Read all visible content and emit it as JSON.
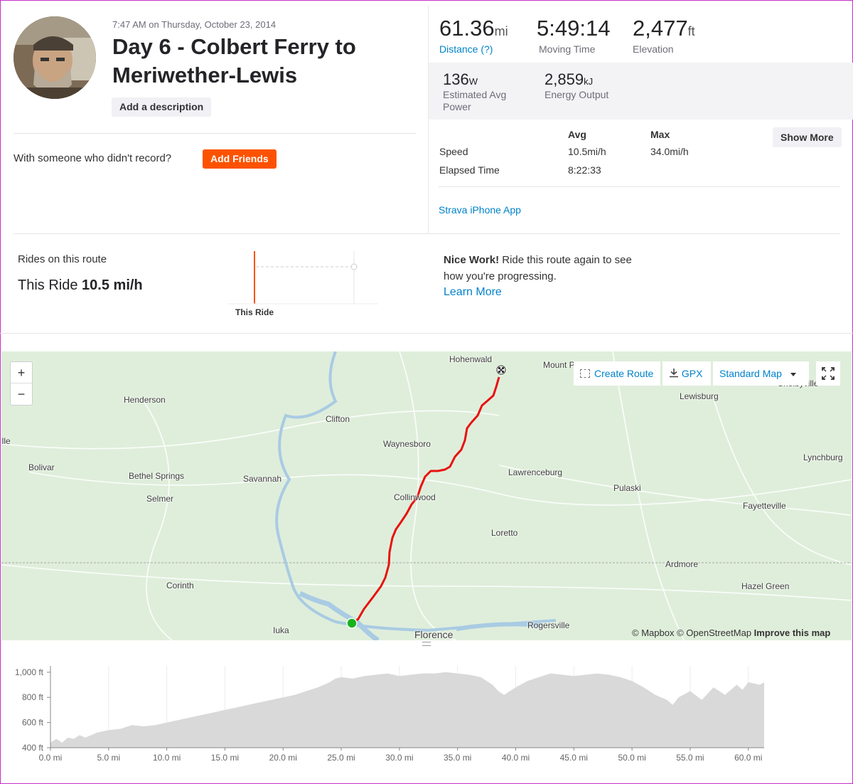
{
  "activity": {
    "timestamp": "7:47 AM on Thursday, October 23, 2014",
    "title": "Day 6 - Colbert Ferry to Meriwether-Lewis",
    "add_description": "Add a description",
    "with_someone": "With someone who didn't record?",
    "add_friends": "Add Friends"
  },
  "stats": {
    "distance": {
      "value": "61.36",
      "unit": "mi",
      "label": "Distance (?)"
    },
    "moving_time": {
      "value": "5:49:14",
      "label": "Moving Time"
    },
    "elevation": {
      "value": "2,477",
      "unit": "ft",
      "label": "Elevation"
    },
    "power": {
      "value": "136",
      "unit": "W",
      "label": "Estimated Avg Power"
    },
    "energy": {
      "value": "2,859",
      "unit": "kJ",
      "label": "Energy Output"
    },
    "table": {
      "avg_header": "Avg",
      "max_header": "Max",
      "rows": [
        {
          "label": "Speed",
          "avg": "10.5mi/h",
          "max": "34.0mi/h"
        },
        {
          "label": "Elapsed Time",
          "avg": "8:22:33",
          "max": ""
        }
      ]
    },
    "show_more": "Show More",
    "device_link": "Strava iPhone App"
  },
  "route": {
    "rides_label": "Rides on this route",
    "this_ride_prefix": "This Ride",
    "this_ride_speed": "10.5 mi/h",
    "chart_label": "This Ride",
    "nice_work_bold": "Nice Work!",
    "nice_work_text": "Ride this route again to see how you're progressing.",
    "learn_more": "Learn More"
  },
  "map": {
    "zoom_in": "+",
    "zoom_out": "−",
    "create_route": "Create Route",
    "gpx": "GPX",
    "map_type": "Standard Map",
    "attribution_mapbox": "© Mapbox",
    "attribution_osm": "© OpenStreetMap",
    "attribution_improve": "Improve this map",
    "places": [
      "Hohenwald",
      "Mount P",
      "Shelbyville",
      "Lewisburg",
      "Henderson",
      "Clifton",
      "Waynesboro",
      "ille",
      "Bolivar",
      "Bethel Springs",
      "Savannah",
      "Lawrenceburg",
      "Lynchburg",
      "Selmer",
      "Collinwood",
      "Pulaski",
      "Fayetteville",
      "Loretto",
      "Ardmore",
      "Corinth",
      "Hazel Green",
      "Iuka",
      "Florence",
      "Rogersville"
    ],
    "route_color": "#e8120f",
    "start_color": "#19b21e"
  },
  "elevation_chart": {
    "y_ticks": [
      "1,000 ft",
      "800 ft",
      "600 ft",
      "400 ft"
    ],
    "x_ticks": [
      "0.0 mi",
      "5.0 mi",
      "10.0 mi",
      "15.0 mi",
      "20.0 mi",
      "25.0 mi",
      "30.0 mi",
      "35.0 mi",
      "40.0 mi",
      "45.0 mi",
      "50.0 mi",
      "55.0 mi",
      "60.0 mi"
    ]
  },
  "chart_data": {
    "type": "area",
    "x": [
      0,
      0.5,
      1,
      1.5,
      2,
      2.5,
      3,
      4,
      5,
      6,
      7,
      8,
      9,
      10,
      11,
      12,
      13,
      14,
      15,
      16,
      17,
      18,
      19,
      20,
      21,
      22,
      23,
      24,
      24.5,
      25,
      26,
      27,
      28,
      29,
      30,
      31,
      32,
      33,
      34,
      35,
      36,
      37,
      38,
      38.5,
      39,
      39.5,
      40,
      41,
      42,
      43,
      44,
      45,
      46,
      47,
      48,
      49,
      50,
      51,
      52,
      53,
      53.5,
      54,
      55,
      56,
      57,
      58,
      59,
      59.5,
      60,
      61,
      61.36
    ],
    "y": [
      440,
      470,
      440,
      480,
      470,
      500,
      480,
      520,
      540,
      550,
      580,
      570,
      580,
      600,
      620,
      640,
      660,
      680,
      700,
      720,
      740,
      760,
      780,
      800,
      820,
      850,
      880,
      920,
      950,
      960,
      950,
      970,
      980,
      990,
      970,
      980,
      990,
      990,
      1000,
      990,
      980,
      960,
      900,
      850,
      820,
      850,
      880,
      930,
      960,
      990,
      980,
      970,
      980,
      990,
      980,
      960,
      930,
      880,
      820,
      780,
      740,
      800,
      850,
      780,
      880,
      820,
      900,
      860,
      920,
      900,
      920
    ],
    "xlabel": "",
    "ylabel": "",
    "xlim": [
      0,
      61.36
    ],
    "ylim": [
      400,
      1050
    ],
    "y_ticks": [
      400,
      600,
      800,
      1000
    ],
    "x_ticks": [
      0,
      5,
      10,
      15,
      20,
      25,
      30,
      35,
      40,
      45,
      50,
      55,
      60
    ],
    "grid": true,
    "fill_color": "#d9d9d9"
  }
}
